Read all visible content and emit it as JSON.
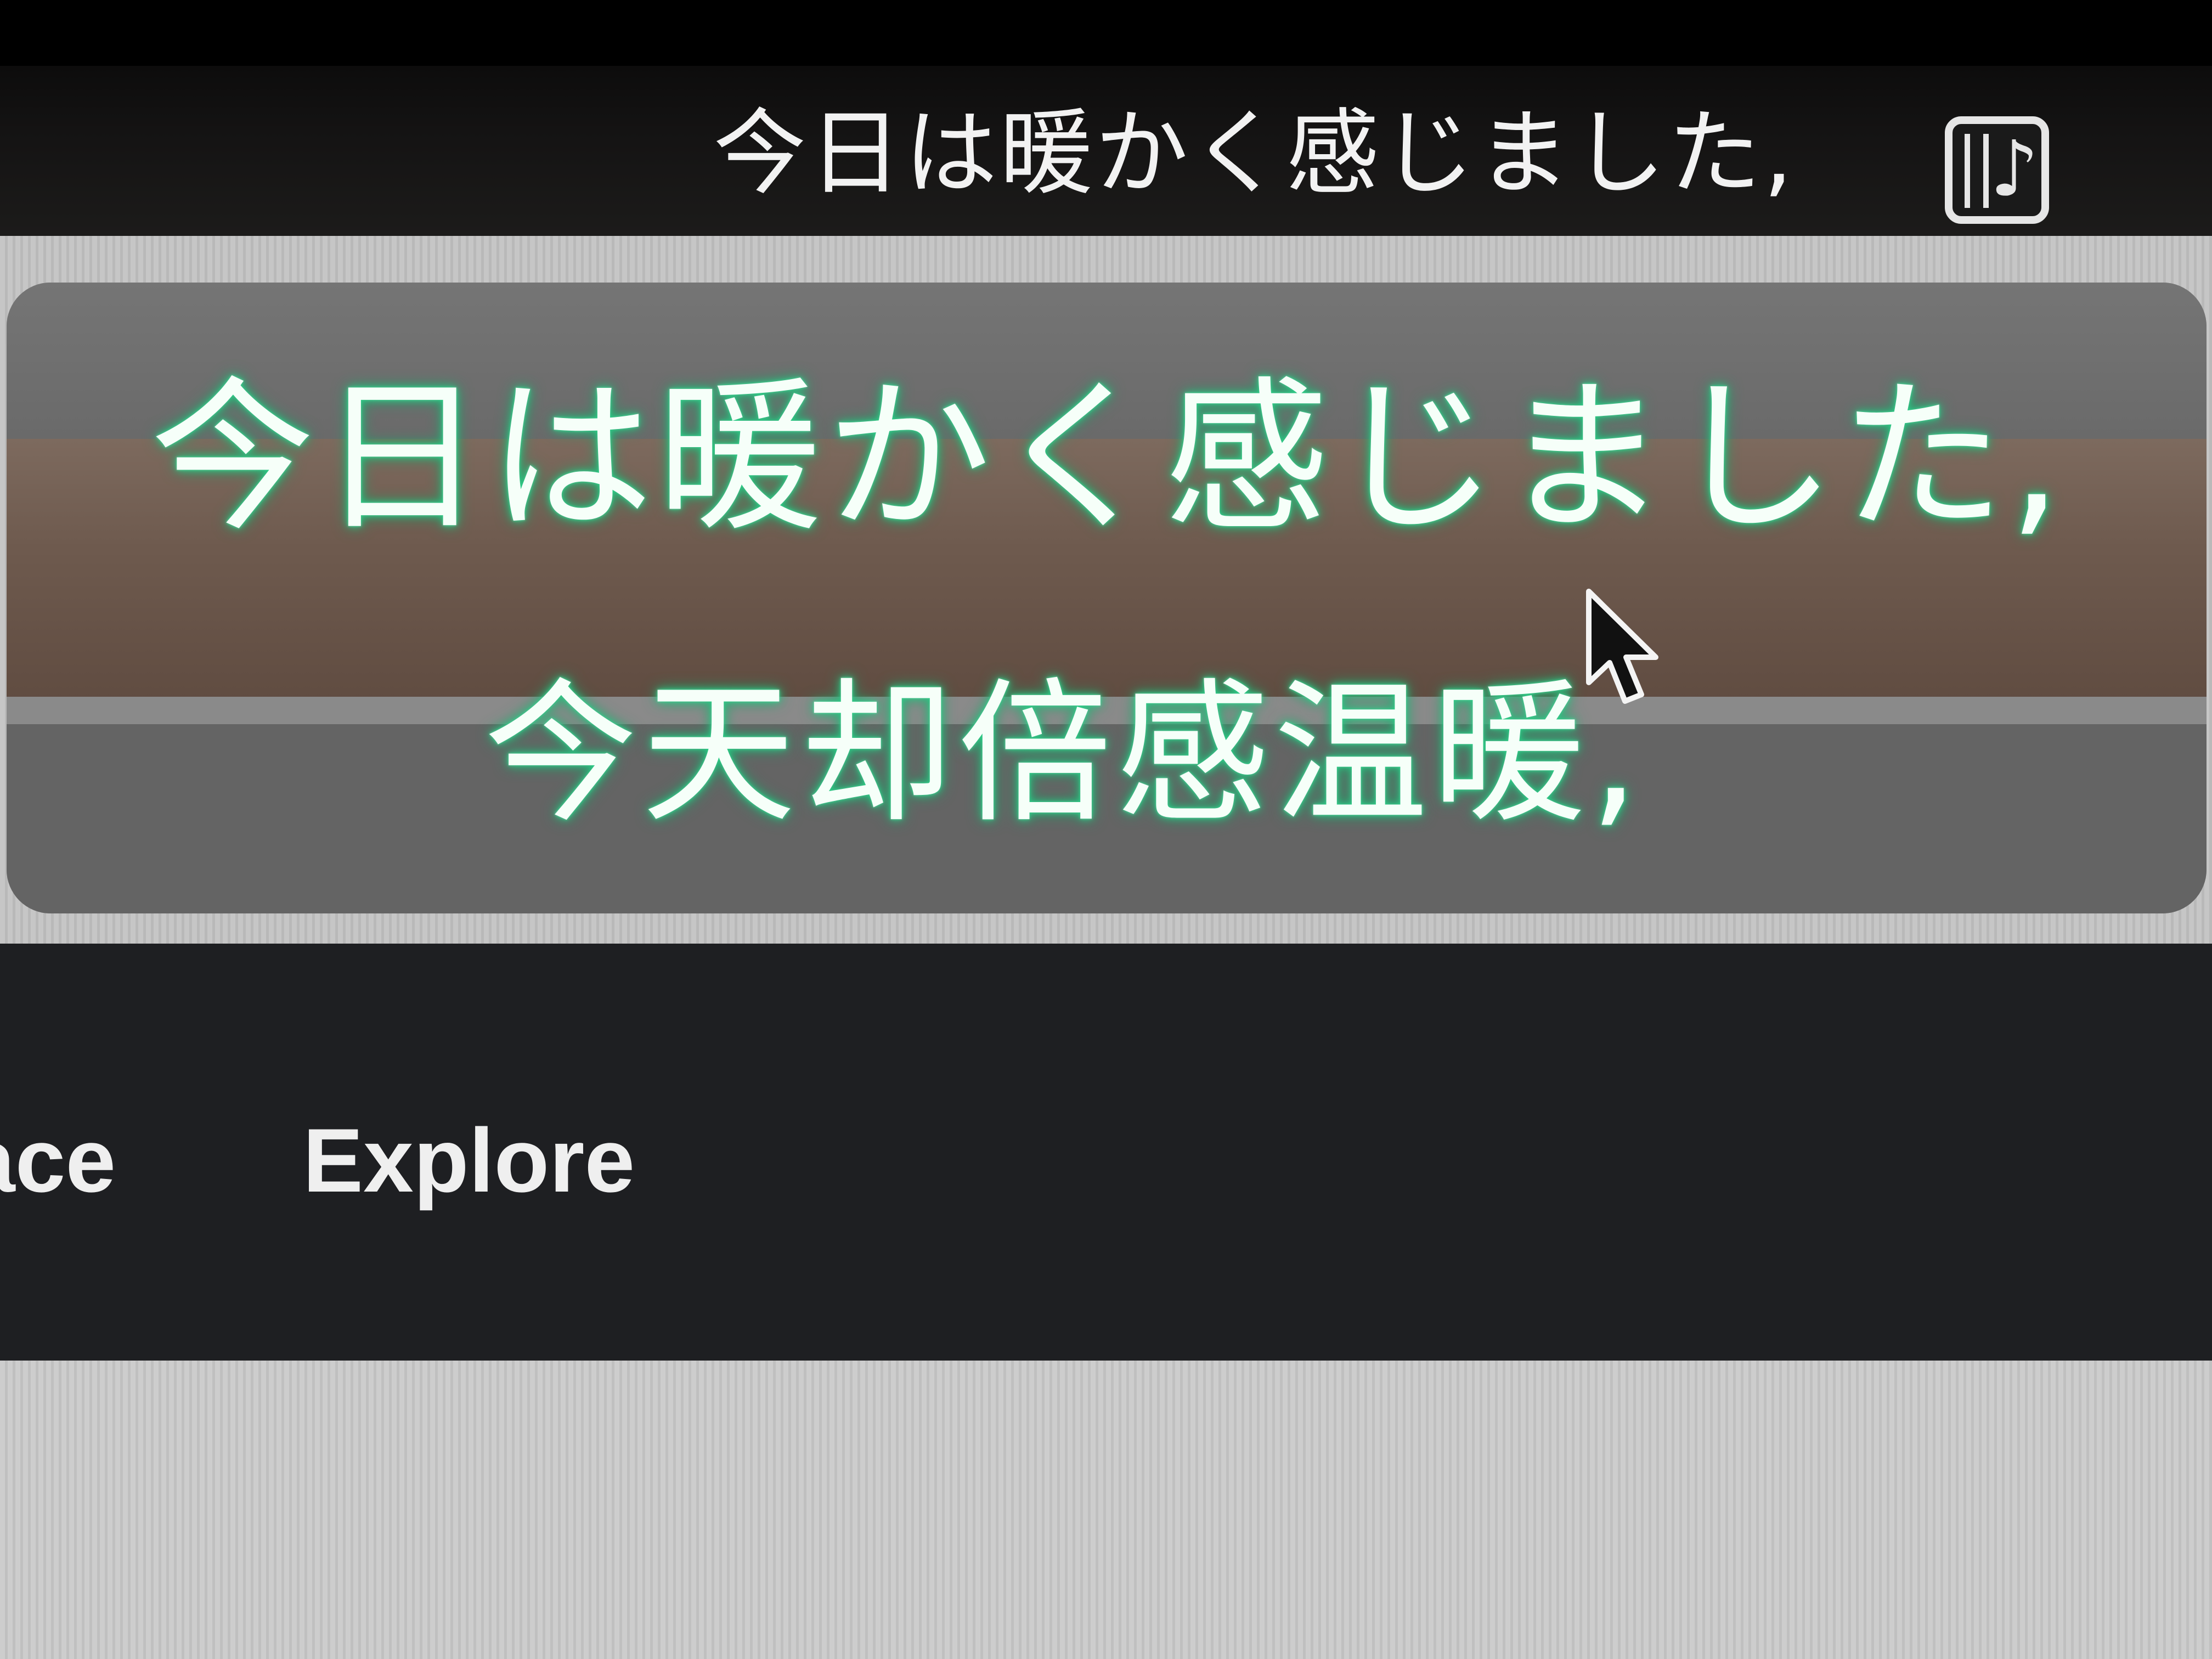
{
  "menubar": {
    "lyric_text": "今日は暖かく感じました,",
    "app_icon": "music-note-icon"
  },
  "lyrics_panel": {
    "original_line": "今日は暖かく感じました,",
    "translation_line": "今天却倍感温暖,",
    "glow_color": "#2fd08a"
  },
  "nav": {
    "items": [
      {
        "label": "lace"
      },
      {
        "label": "Explore"
      }
    ]
  },
  "cursor": "arrow-cursor-icon"
}
